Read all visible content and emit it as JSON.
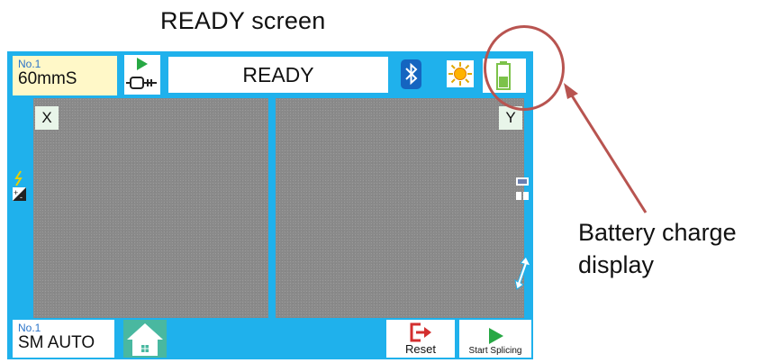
{
  "captions": {
    "title": "READY screen",
    "annotation_line1": "Battery charge",
    "annotation_line2": "display"
  },
  "header": {
    "program_no": "No.1",
    "program_value": "60mmS",
    "status_text": "READY",
    "icons": [
      "fiber-holder-icon",
      "bluetooth-icon",
      "sun-icon",
      "battery-icon"
    ]
  },
  "cameras": {
    "left_label": "X",
    "right_label": "Y"
  },
  "footer": {
    "mode_no": "No.1",
    "mode_value": "SM AUTO",
    "reset_label": "Reset",
    "start_label": "Start Splicing"
  },
  "colors": {
    "frame": "#1fb1ec",
    "program_bg": "#fff8c8",
    "highlight": "#b85450",
    "battery_fill": "#7cc24a",
    "reset_icon": "#d32f2f",
    "start_icon": "#27a844"
  }
}
